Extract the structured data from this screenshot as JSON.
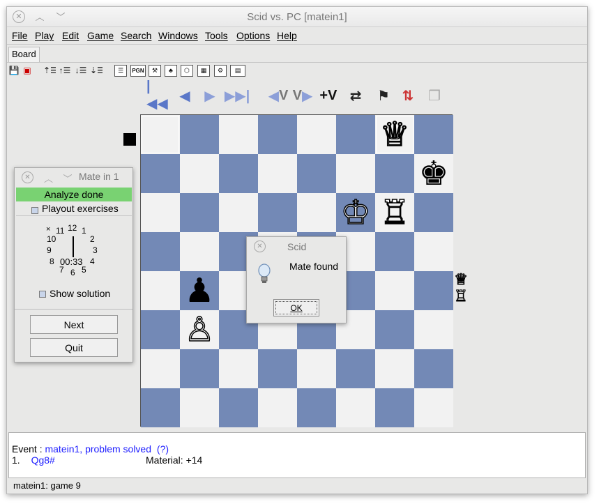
{
  "window": {
    "title": "Scid vs. PC [matein1]"
  },
  "menu": [
    "File",
    "Play",
    "Edit",
    "Game",
    "Search",
    "Windows",
    "Tools",
    "Options",
    "Help"
  ],
  "tab": {
    "label": "Board"
  },
  "toolbar": {
    "pgn_label": "PGN"
  },
  "nav": {
    "var_back": "V",
    "var_fwd": "V",
    "var_add": "+V"
  },
  "board": {
    "side_to_move": "black",
    "squares": [
      [
        "",
        "",
        "",
        "",
        "",
        "",
        "♕",
        ""
      ],
      [
        "",
        "",
        "",
        "",
        "",
        "",
        "",
        "♚"
      ],
      [
        "",
        "",
        "",
        "",
        "",
        "♔",
        "♖",
        ""
      ],
      [
        "",
        "",
        "",
        "",
        "",
        "",
        "",
        ""
      ],
      [
        "",
        "♟",
        "",
        "",
        "",
        "",
        "",
        ""
      ],
      [
        "",
        "♙",
        "",
        "",
        "",
        "",
        "",
        ""
      ],
      [
        "",
        "",
        "",
        "",
        "",
        "",
        "",
        ""
      ],
      [
        "",
        "",
        "",
        "",
        "",
        "",
        "",
        ""
      ]
    ],
    "captured": [
      "♕",
      "♖"
    ]
  },
  "mate_window": {
    "title": "Mate in 1",
    "status": "Analyze done",
    "playout_label": "Playout exercises",
    "clock_time": "00:33",
    "clock_numbers": [
      "12",
      "1",
      "2",
      "3",
      "4",
      "5",
      "6",
      "7",
      "8",
      "9",
      "10",
      "11"
    ],
    "show_solution_label": "Show solution",
    "next_label": "Next",
    "quit_label": "Quit"
  },
  "dialog": {
    "title": "Scid",
    "message": "Mate found",
    "ok_label": "OK"
  },
  "pgn": {
    "annotation": "?  --  ?",
    "event_label": "Event :",
    "event_value": "matein1, problem solved",
    "event_extra": "(?)",
    "move_number": "1.",
    "move": "Qg8#",
    "material": "Material: +14"
  },
  "status": {
    "text": "matein1: game  9"
  }
}
